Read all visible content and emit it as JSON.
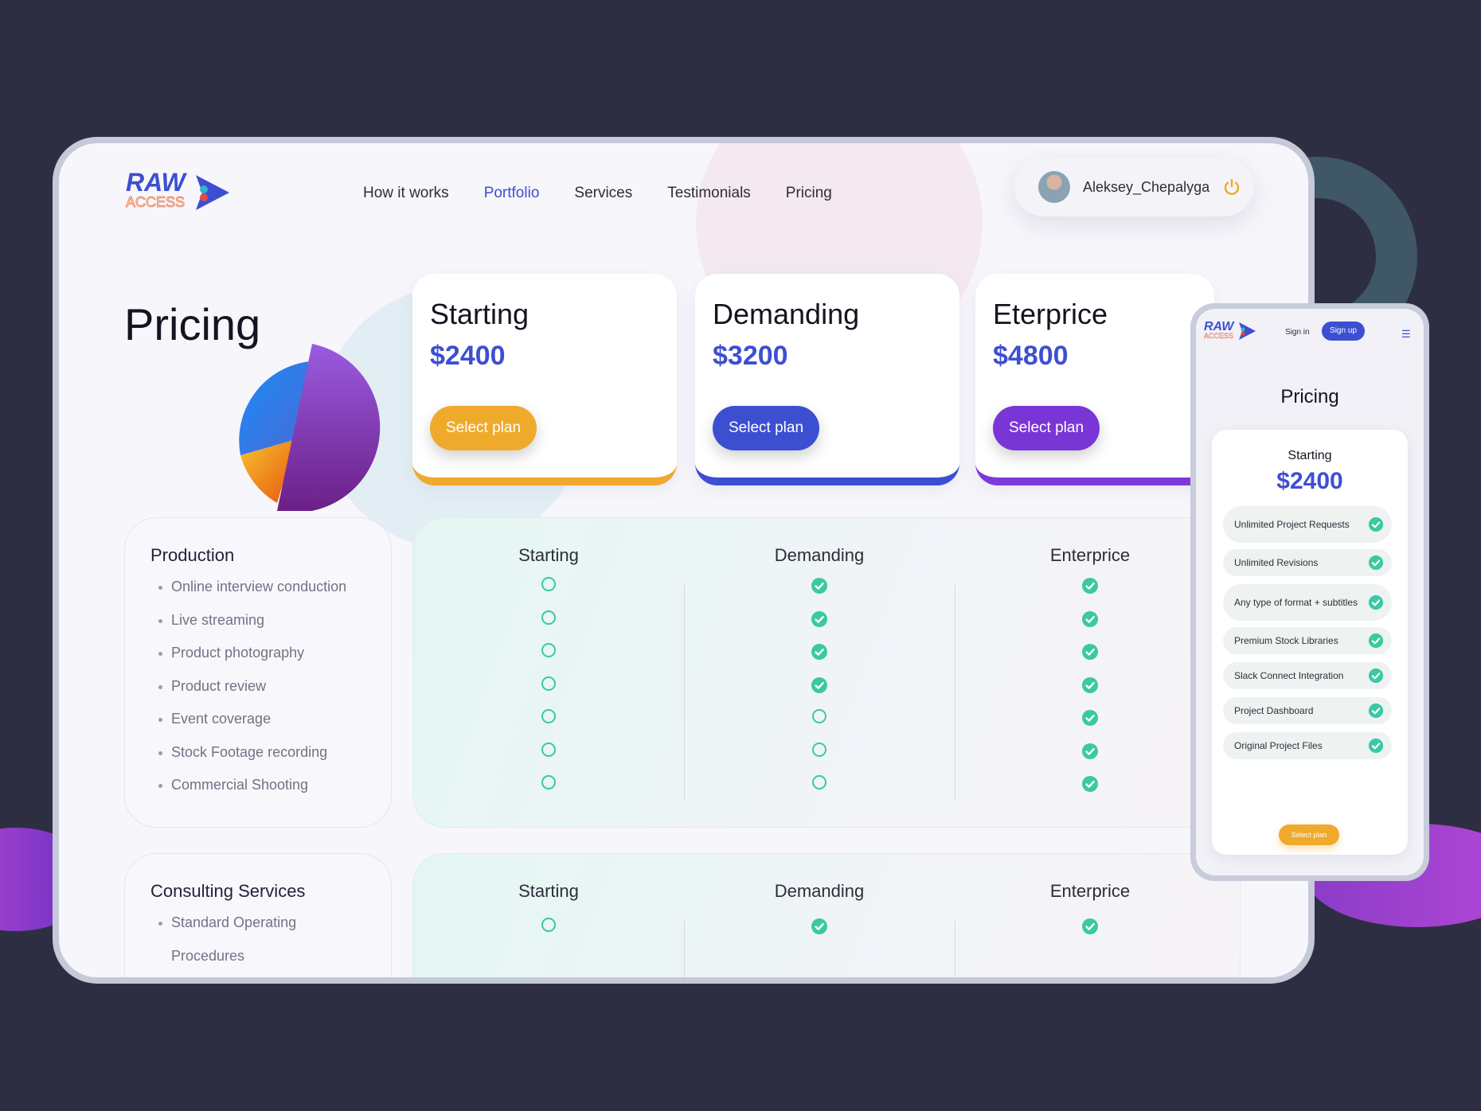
{
  "brand": {
    "logo_text": "RAW",
    "logo_subtext": "ACCESS",
    "accent": "#3d4fd1"
  },
  "nav": [
    {
      "label": "How it works"
    },
    {
      "label": "Portfolio",
      "active": true
    },
    {
      "label": "Services"
    },
    {
      "label": "Testimonials"
    },
    {
      "label": "Pricing"
    }
  ],
  "user": {
    "name": "Aleksey_Chepalyga",
    "avatar_icon": "user-avatar",
    "power_icon": "power-icon"
  },
  "page_title": "Pricing",
  "plans": [
    {
      "name": "Starting",
      "price": "$2400",
      "button": "Select plan",
      "color": "#efaa2c"
    },
    {
      "name": "Demanding",
      "price": "$3200",
      "button": "Select plan",
      "color": "#3d4fd1"
    },
    {
      "name": "Eterprice",
      "price": "$4800",
      "button": "Select plan",
      "color": "#7a35d6"
    }
  ],
  "table_columns": [
    "Starting",
    "Demanding",
    "Enterprice"
  ],
  "production": {
    "title": "Production",
    "features": [
      "Online interview conduction",
      "Live streaming",
      "Product photography",
      "Product review",
      "Event coverage",
      "Stock Footage recording",
      "Commercial Shooting"
    ],
    "included": [
      [
        false,
        true,
        true
      ],
      [
        false,
        true,
        true
      ],
      [
        false,
        true,
        true
      ],
      [
        false,
        true,
        true
      ],
      [
        false,
        false,
        true
      ],
      [
        false,
        false,
        true
      ],
      [
        false,
        false,
        true
      ]
    ]
  },
  "consulting": {
    "title": "Consulting Services",
    "features": [
      "Standard Operating",
      "Procedures"
    ],
    "included": [
      [
        false,
        true,
        true
      ]
    ]
  },
  "mobile": {
    "sign_in": "Sign in",
    "sign_up": "Sign up",
    "menu_icon": "hamburger-menu-icon",
    "title": "Pricing",
    "plan_name": "Starting",
    "plan_price": "$2400",
    "features": [
      "Unlimited Project Requests",
      "Unlimited Revisions",
      "Any type of format + subtitles",
      "Premium Stock Libraries",
      "Slack Connect Integration",
      "Project Dashboard",
      "Original Project Files"
    ],
    "button": "Select plan"
  },
  "colors": {
    "check": "#3bc9a2",
    "orange": "#efaa2c",
    "blue": "#3d4fd1",
    "purple": "#7a35d6"
  }
}
